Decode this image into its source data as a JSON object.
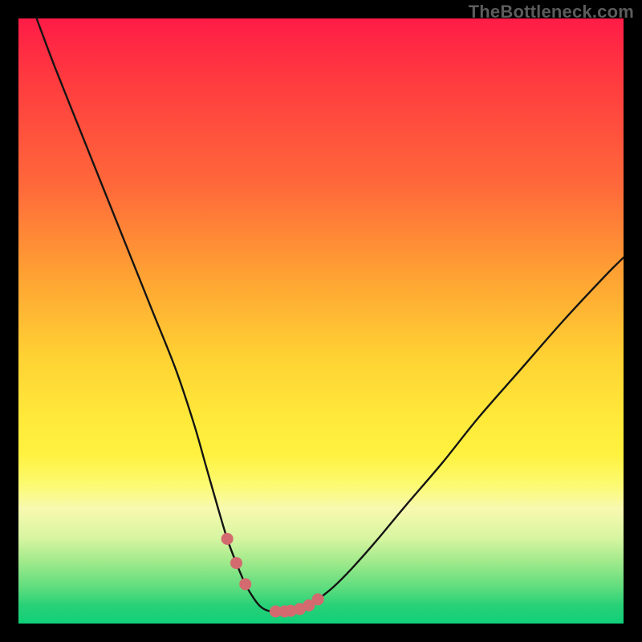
{
  "watermark": "TheBottleneck.com",
  "chart_data": {
    "type": "line",
    "title": "",
    "xlabel": "",
    "ylabel": "",
    "xlim": [
      0,
      100
    ],
    "ylim": [
      0,
      100
    ],
    "series": [
      {
        "name": "bottleneck-curve",
        "x": [
          3,
          6,
          10,
          14,
          18,
          22,
          26,
          29,
          31,
          33,
          34.5,
          36,
          37.5,
          39,
          40,
          41,
          42,
          43,
          44,
          45,
          46.5,
          48,
          49.5,
          52,
          55,
          59,
          64,
          70,
          76,
          83,
          90,
          97,
          100
        ],
        "y": [
          100,
          92,
          82,
          72,
          62,
          52,
          42,
          33,
          26,
          19,
          14,
          10,
          6.5,
          4,
          2.8,
          2.2,
          2,
          2,
          2,
          2.1,
          2.4,
          3,
          4,
          6,
          9,
          13.5,
          19.5,
          26.5,
          34,
          42,
          50,
          57.5,
          60.5
        ]
      },
      {
        "name": "marker-dots",
        "x": [
          34.5,
          36,
          37.5,
          42.5,
          44,
          45,
          46.5,
          48,
          49.5
        ],
        "y": [
          14,
          10,
          6.5,
          2,
          2,
          2.1,
          2.4,
          3,
          4
        ]
      }
    ],
    "colors": {
      "curve": "#141414",
      "markers": "#d36a6f"
    }
  }
}
